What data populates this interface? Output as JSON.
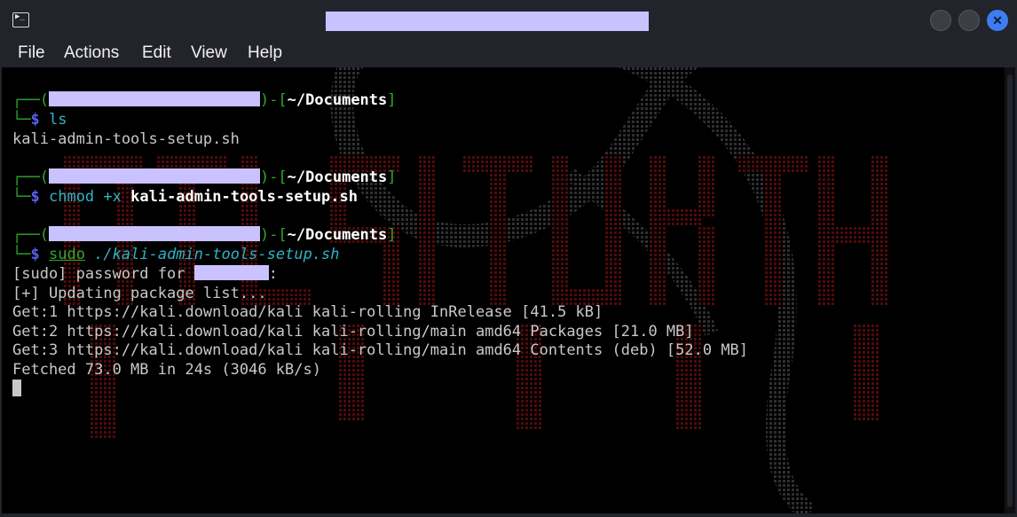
{
  "window": {
    "title_redacted": true,
    "icon_glyph": "▶_",
    "close_glyph": "✕"
  },
  "menu": {
    "items": [
      "File",
      "Actions",
      "Edit",
      "View",
      "Help"
    ]
  },
  "prompt": {
    "open": "┌──(",
    "mid": ")-[",
    "dir": "~/Documents",
    "close": "]",
    "lower": "└─",
    "dollar": "$"
  },
  "commands": {
    "first": "ls",
    "second_cmd": "chmod +x",
    "second_arg": "kali-admin-tools-setup.sh",
    "third_sudo": "sudo",
    "third_arg": "./kali-admin-tools-setup.sh"
  },
  "output": {
    "ls_result": "kali-admin-tools-setup.sh",
    "sudo_prompt": "[sudo] password for",
    "sudo_colon": ":",
    "updating": "[+] Updating package list...",
    "get1": "Get:1 https://kali.download/kali kali-rolling InRelease [41.5 kB]",
    "get2": "Get:2 https://kali.download/kali kali-rolling/main amd64 Packages [21.0 MB]",
    "get3": "Get:3 https://kali.download/kali kali-rolling/main amd64 Contents (deb) [52.0 MB]",
    "fetched": "Fetched 73.0 MB in 24s (3046 kB/s)"
  },
  "colors": {
    "window_bg": "#22232b",
    "terminal_bg": "#000000",
    "prompt_frame": "#2da82a",
    "prompt_dollar": "#5b5ff2",
    "command": "#2eb3c6",
    "output_text": "#c8c8c8",
    "redaction": "#c9c2ff",
    "close_button": "#3d7df0",
    "wallpaper_red": "#5a0c0c",
    "wallpaper_grey": "#3a3a3a"
  }
}
